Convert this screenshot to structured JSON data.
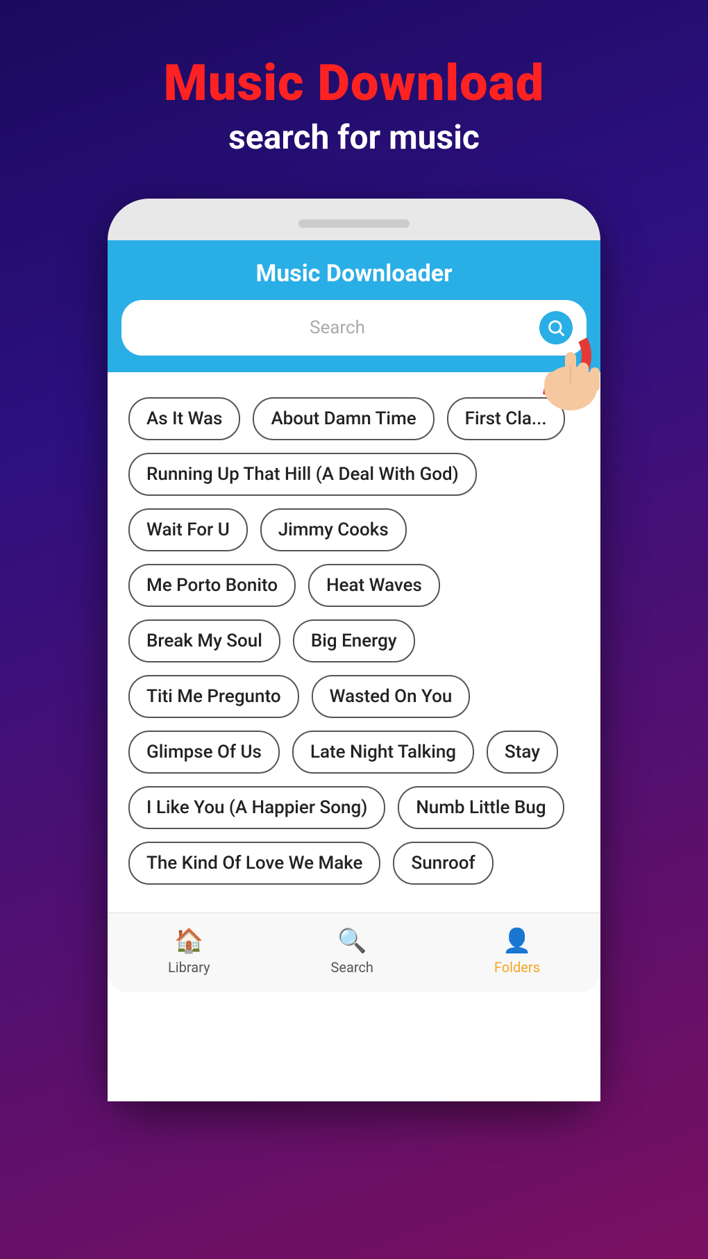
{
  "header": {
    "main_title": "Music Download",
    "sub_title": "search for music"
  },
  "app": {
    "title": "Music Downloader",
    "search_placeholder": "Search"
  },
  "tags": [
    "As It Was",
    "About Damn Time",
    "First Cla...",
    "Running Up That Hill (A Deal With God)",
    "Wait For U",
    "Jimmy Cooks",
    "Me Porto Bonito",
    "Heat Waves",
    "Break My Soul",
    "Big Energy",
    "Titi Me Pregunto",
    "Wasted On You",
    "Glimpse Of Us",
    "Late Night Talking",
    "Stay",
    "I Like You (A Happier Song)",
    "Numb Little Bug",
    "The Kind Of Love We Make",
    "Sunroof"
  ],
  "nav": {
    "items": [
      {
        "label": "Library",
        "icon": "🏠",
        "active": false
      },
      {
        "label": "Search",
        "icon": "🔍",
        "active": false
      },
      {
        "label": "Folders",
        "icon": "👤",
        "active": true
      }
    ]
  }
}
